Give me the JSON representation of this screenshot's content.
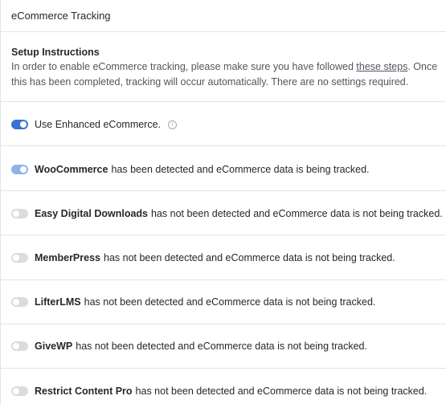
{
  "panel": {
    "title": "eCommerce Tracking"
  },
  "setup": {
    "title": "Setup Instructions",
    "text_before_link": "In order to enable eCommerce tracking, please make sure you have followed ",
    "link_text": "these steps",
    "text_after_link": ". Once this has been completed, tracking will occur automatically. There are no settings required."
  },
  "enhanced": {
    "label": "Use Enhanced eCommerce.",
    "enabled": true,
    "info_icon": "info-icon"
  },
  "integrations": [
    {
      "name": "WooCommerce",
      "status": "has been detected and eCommerce data is being tracked.",
      "detected": true
    },
    {
      "name": "Easy Digital Downloads",
      "status": "has not been detected and eCommerce data is not being tracked.",
      "detected": false
    },
    {
      "name": "MemberPress",
      "status": "has not been detected and eCommerce data is not being tracked.",
      "detected": false
    },
    {
      "name": "LifterLMS",
      "status": "has not been detected and eCommerce data is not being tracked.",
      "detected": false
    },
    {
      "name": "GiveWP",
      "status": "has not been detected and eCommerce data is not being tracked.",
      "detected": false
    },
    {
      "name": "Restrict Content Pro",
      "status": "has not been detected and eCommerce data is not being tracked.",
      "detected": false
    }
  ],
  "colors": {
    "toggle_on": "#3a72d6",
    "toggle_on_disabled": "#8fb3e8",
    "toggle_off": "#dcdcde",
    "border": "#e2e4e7"
  }
}
